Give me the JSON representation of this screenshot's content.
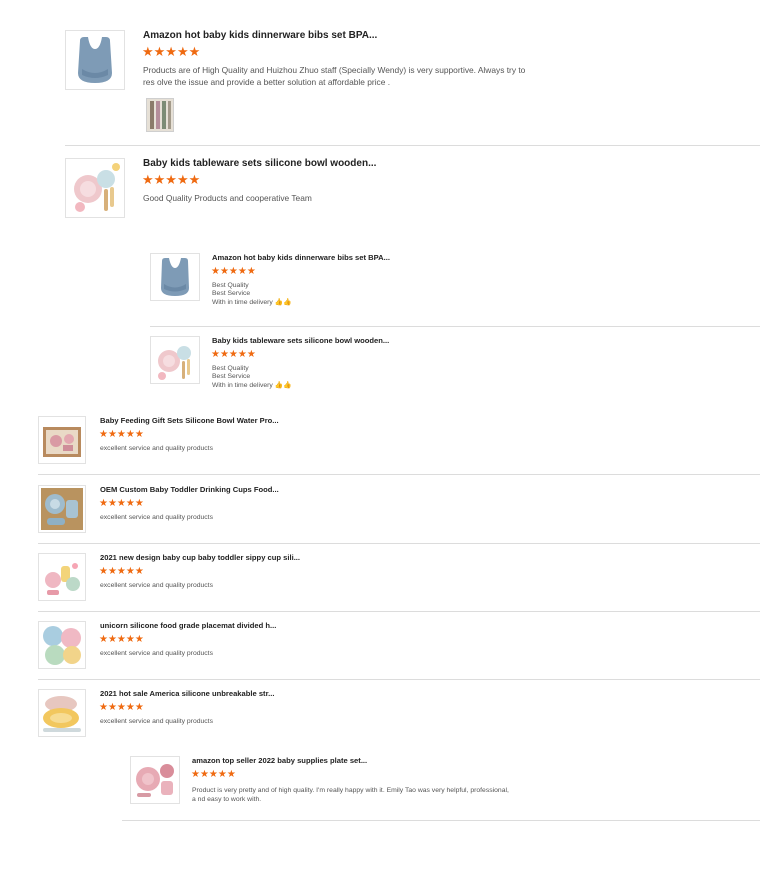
{
  "reviews_top": [
    {
      "product_title": "Amazon hot baby kids dinnerware bibs set BPA...",
      "stars": "★★★★★",
      "comment": "Products are of High Quality and Huizhou Zhuo staff (Specially Wendy) is very supportive. Always try to res olve the issue and provide a better solution at affordable price .",
      "image": "blue-bib-image"
    },
    {
      "product_title": "Baby kids tableware sets silicone bowl wooden...",
      "stars": "★★★★★",
      "comment": "Good Quality Products and cooperative Team",
      "image": "tableware-set-image"
    }
  ],
  "reviews_nested": [
    {
      "product_title": "Amazon hot baby kids dinnerware bibs set BPA...",
      "stars": "★★★★★",
      "lines": [
        "Best Quality",
        "Best Service",
        "With in time delivery 👍👍"
      ]
    },
    {
      "product_title": "Baby kids tableware sets silicone bowl wooden...",
      "stars": "★★★★★",
      "lines": [
        "Best Quality",
        "Best Service",
        "With in time delivery 👍👍"
      ]
    }
  ],
  "reviews_list": [
    {
      "product_title": "Baby Feeding Gift Sets Silicone Bowl Water Pro...",
      "stars": "★★★★★",
      "comment": "excellent service and quality products"
    },
    {
      "product_title": "OEM Custom Baby Toddler Drinking Cups Food...",
      "stars": "★★★★★",
      "comment": "excellent service and quality products"
    },
    {
      "product_title": "2021 new design baby cup baby toddler sippy cup sili...",
      "stars": "★★★★★",
      "comment": "excellent service and quality products"
    },
    {
      "product_title": "unicorn silicone food grade placemat divided h...",
      "stars": "★★★★★",
      "comment": "excellent service and quality products"
    },
    {
      "product_title": "2021 hot sale America silicone unbreakable str...",
      "stars": "★★★★★",
      "comment": "excellent service and quality products"
    }
  ],
  "review_last": {
    "product_title": "amazon top seller 2022 baby supplies plate set...",
    "stars": "★★★★★",
    "comment": "Product is very pretty and of high quality. I'm really happy with it. Emily Tao was very helpful, professional, a nd easy to work with."
  },
  "colors": {
    "star": "#ef6a11",
    "divider": "#dcdcdc",
    "text": "#555555"
  }
}
